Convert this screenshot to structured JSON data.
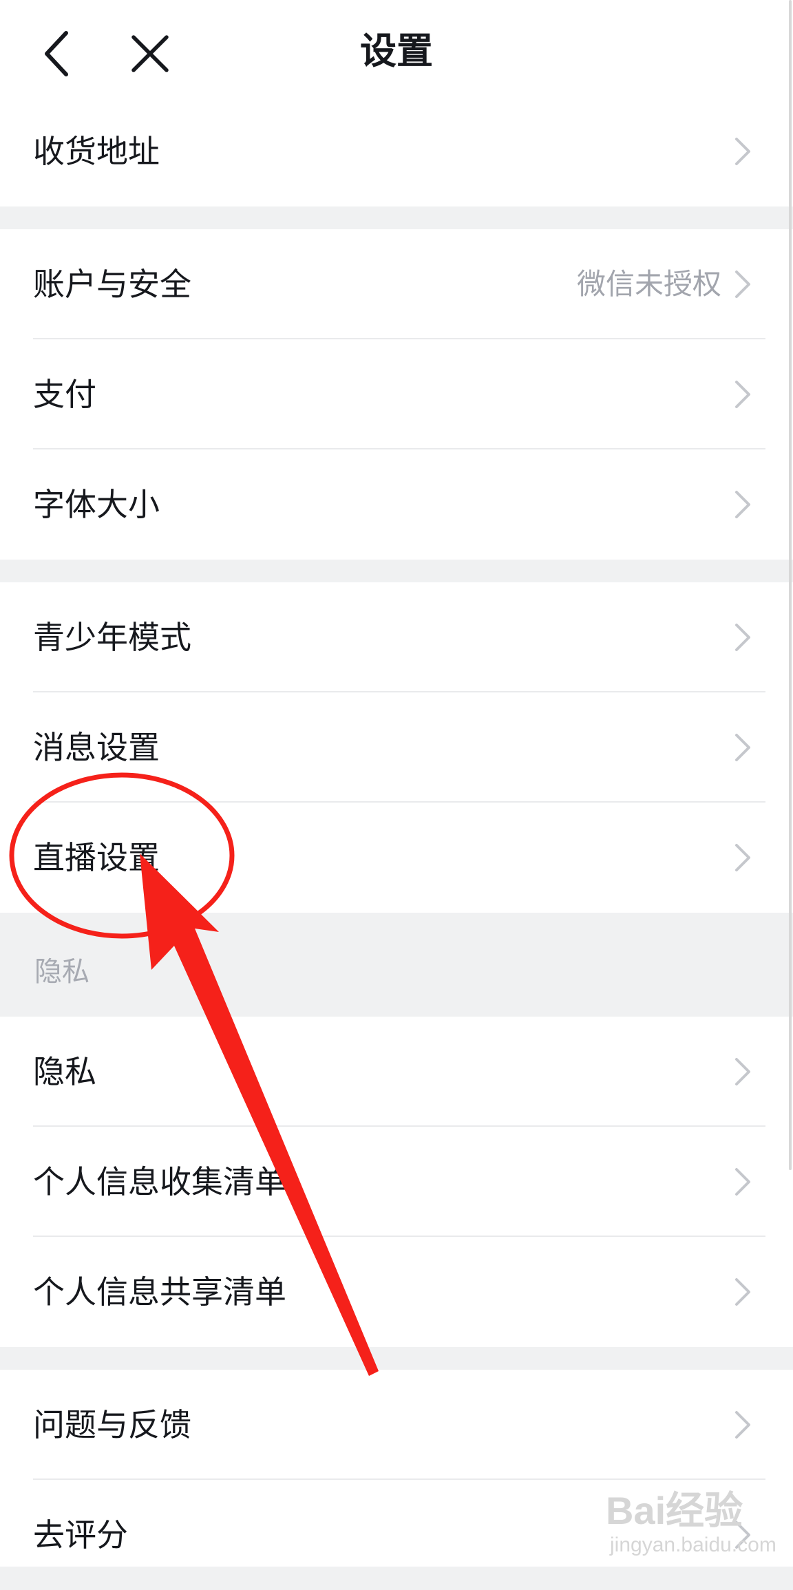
{
  "header": {
    "title": "设置"
  },
  "rows": [
    {
      "label": "收货地址"
    },
    {
      "label": "账户与安全",
      "value": "微信未授权"
    },
    {
      "label": "支付"
    },
    {
      "label": "字体大小"
    },
    {
      "label": "青少年模式"
    },
    {
      "label": "消息设置"
    },
    {
      "label": "直播设置"
    },
    {
      "label": "隐私"
    },
    {
      "label": "个人信息收集清单"
    },
    {
      "label": "个人信息共享清单"
    },
    {
      "label": "问题与反馈"
    },
    {
      "label": "去评分"
    }
  ],
  "privacy_section": {
    "title": "隐私"
  },
  "watermark": {
    "brand": "Bai经验",
    "url": "jingyan.baidu.com"
  },
  "colors": {
    "annotation": "#f5211a",
    "chevron": "#c5c7cc",
    "value_text": "#a2a5ad"
  },
  "icons": {
    "back": "chevron-left-icon",
    "close": "close-icon",
    "row_arrow": "chevron-right-icon"
  }
}
